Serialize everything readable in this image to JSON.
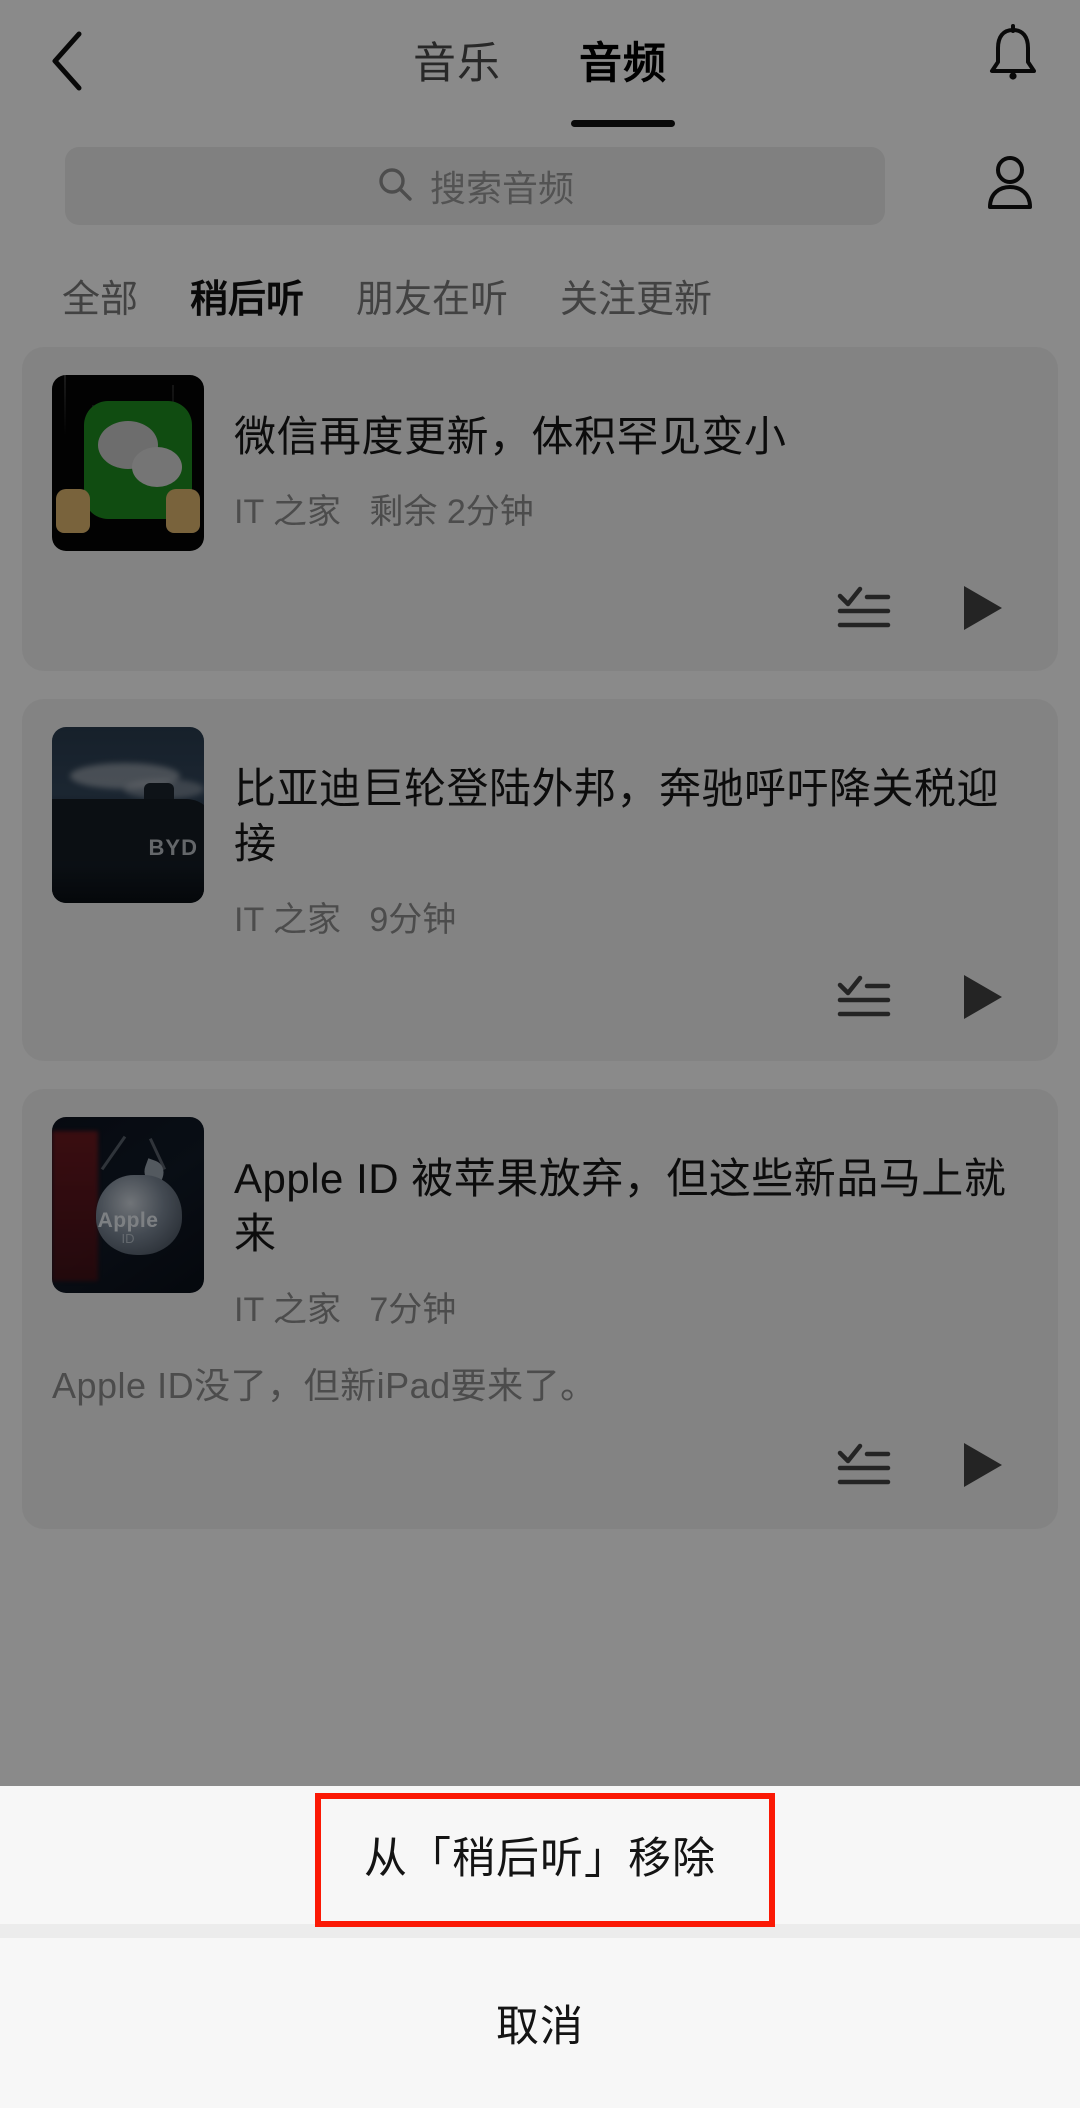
{
  "header": {
    "back_icon": "chevron-left-icon",
    "bell_icon": "bell-icon",
    "tabs": [
      {
        "label": "音乐",
        "active": false
      },
      {
        "label": "音频",
        "active": true
      }
    ]
  },
  "search": {
    "placeholder": "搜索音频",
    "icon": "search-icon",
    "avatar_icon": "person-icon"
  },
  "filters": [
    {
      "label": "全部",
      "active": false
    },
    {
      "label": "稍后听",
      "active": true
    },
    {
      "label": "朋友在听",
      "active": false
    },
    {
      "label": "关注更新",
      "active": false
    }
  ],
  "cards": [
    {
      "title": "微信再度更新，体积罕见变小",
      "source": "IT 之家",
      "time": "剩余 2分钟",
      "description": "",
      "thumb_alt": "wechat-logo-thumbnail",
      "thumb_text": "",
      "playlist_icon": "add-to-playlist-icon",
      "play_icon": "play-icon"
    },
    {
      "title": "比亚迪巨轮登陆外邦，奔驰呼吁降关税迎接",
      "source": "IT 之家",
      "time": "9分钟",
      "description": "",
      "thumb_alt": "byd-ship-thumbnail",
      "thumb_text": "BYD",
      "playlist_icon": "add-to-playlist-icon",
      "play_icon": "play-icon"
    },
    {
      "title": "Apple ID 被苹果放弃，但这些新品马上就来",
      "source": "IT 之家",
      "time": "7分钟",
      "description": "Apple ID没了，但新iPad要来了。",
      "thumb_alt": "apple-logo-thumbnail",
      "thumb_text": "Apple",
      "thumb_subtext": "ID",
      "playlist_icon": "add-to-playlist-icon",
      "play_icon": "play-icon"
    }
  ],
  "action_sheet": {
    "remove_label": "从「稍后听」移除",
    "cancel_label": "取消",
    "highlight_color": "#fb1905"
  }
}
